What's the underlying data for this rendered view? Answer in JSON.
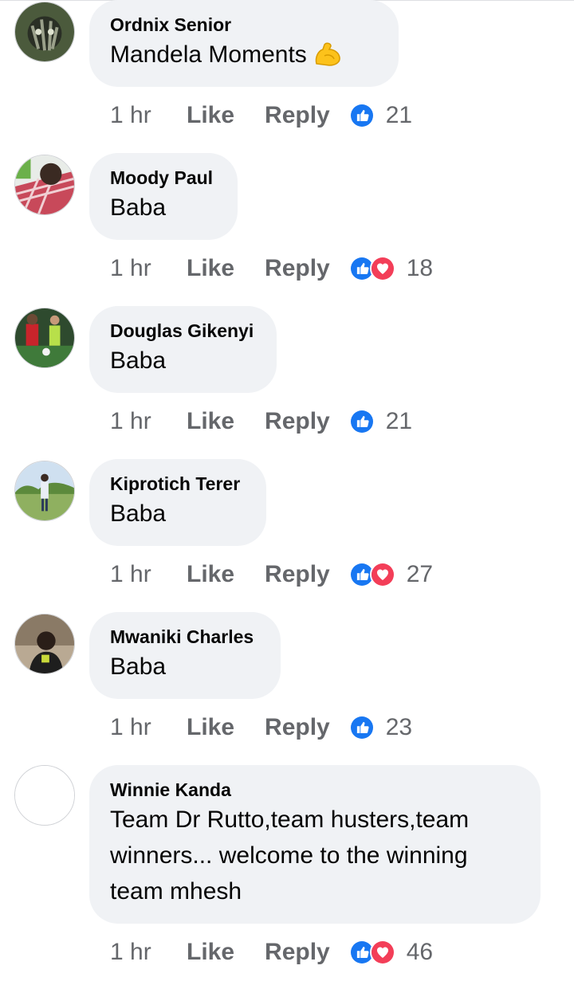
{
  "comments": [
    {
      "author": "Ordnix Senior",
      "text": "Mandela Moments",
      "emoji": "flexed-biceps-icon",
      "time": "1 hr",
      "like_label": "Like",
      "reply_label": "Reply",
      "reactions": [
        "like"
      ],
      "reaction_count": "21"
    },
    {
      "author": "Moody Paul",
      "text": "Baba",
      "time": "1 hr",
      "like_label": "Like",
      "reply_label": "Reply",
      "reactions": [
        "like",
        "love"
      ],
      "reaction_count": "18"
    },
    {
      "author": "Douglas Gikenyi",
      "text": "Baba",
      "time": "1 hr",
      "like_label": "Like",
      "reply_label": "Reply",
      "reactions": [
        "like"
      ],
      "reaction_count": "21"
    },
    {
      "author": "Kiprotich Terer",
      "text": "Baba",
      "time": "1 hr",
      "like_label": "Like",
      "reply_label": "Reply",
      "reactions": [
        "like",
        "love"
      ],
      "reaction_count": "27"
    },
    {
      "author": "Mwaniki Charles",
      "text": "Baba",
      "time": "1 hr",
      "like_label": "Like",
      "reply_label": "Reply",
      "reactions": [
        "like"
      ],
      "reaction_count": "23"
    },
    {
      "author": "Winnie Kanda",
      "text": "Team Dr Rutto,team husters,team winners... welcome to the winning team mhesh",
      "time": "1 hr",
      "like_label": "Like",
      "reply_label": "Reply",
      "reactions": [
        "like",
        "love"
      ],
      "reaction_count": "46"
    }
  ],
  "colors": {
    "like_blue": "#1877f2",
    "love_red": "#f33e58",
    "bubble_bg": "#f0f2f5",
    "meta_gray": "#65676b"
  }
}
